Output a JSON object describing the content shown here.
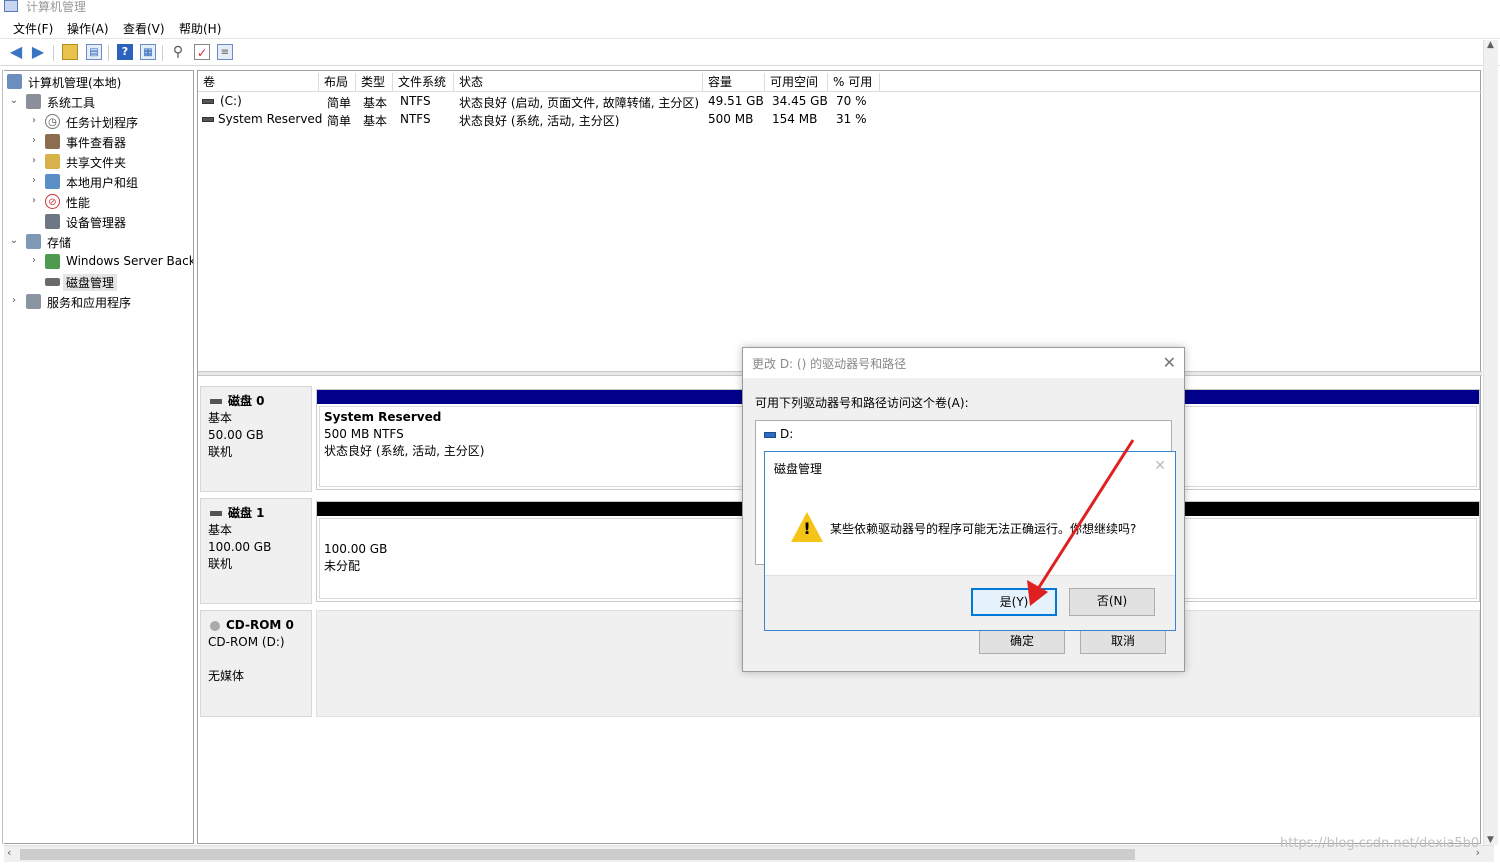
{
  "window": {
    "title": "计算机管理"
  },
  "menu": [
    "文件(F)",
    "操作(A)",
    "查看(V)",
    "帮助(H)"
  ],
  "tree": {
    "root": "计算机管理(本地)",
    "system_tools": "系统工具",
    "task_scheduler": "任务计划程序",
    "event_viewer": "事件查看器",
    "shared_folders": "共享文件夹",
    "local_users": "本地用户和组",
    "performance": "性能",
    "device_manager": "设备管理器",
    "storage": "存储",
    "windows_backup": "Windows Server Back",
    "disk_management": "磁盘管理",
    "services_apps": "服务和应用程序"
  },
  "volume_table": {
    "columns": [
      "卷",
      "布局",
      "类型",
      "文件系统",
      "状态",
      "容量",
      "可用空间",
      "% 可用"
    ],
    "rows": [
      [
        "(C:)",
        "简单",
        "基本",
        "NTFS",
        "状态良好 (启动, 页面文件, 故障转储, 主分区)",
        "49.51 GB",
        "34.45 GB",
        "70 %"
      ],
      [
        "System Reserved",
        "简单",
        "基本",
        "NTFS",
        "状态良好 (系统, 活动, 主分区)",
        "500 MB",
        "154 MB",
        "31 %"
      ]
    ]
  },
  "disks": {
    "disk0": {
      "name": "磁盘 0",
      "type": "基本",
      "size": "50.00 GB",
      "status": "联机",
      "partition": {
        "title": "System Reserved",
        "detail": "500 MB NTFS",
        "status": "状态良好 (系统, 活动, 主分区)"
      }
    },
    "disk1": {
      "name": "磁盘 1",
      "type": "基本",
      "size": "100.00 GB",
      "status": "联机",
      "partition": {
        "size": "100.00 GB",
        "status": "未分配"
      }
    },
    "cdrom0": {
      "name": "CD-ROM 0",
      "drive": "CD-ROM (D:)",
      "status": "无媒体"
    }
  },
  "change_letter_dialog": {
    "title": "更改 D: () 的驱动器号和路径",
    "prompt": "可用下列驱动器号和路径访问这个卷(A):",
    "list_item": "D:",
    "ok": "确定",
    "cancel": "取消"
  },
  "confirm_dialog": {
    "title": "磁盘管理",
    "message": "某些依赖驱动器号的程序可能无法正确运行。你想继续吗?",
    "yes": "是(Y)",
    "no": "否(N)"
  },
  "watermark": "https://blog.csdn.net/dexia5b0",
  "colors": {
    "disk0_bar": "#00008b",
    "disk1_bar": "#000000",
    "arrow": "#e02020"
  }
}
